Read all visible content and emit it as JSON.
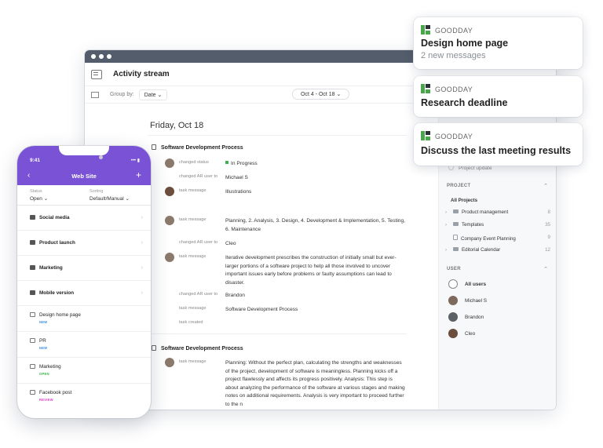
{
  "activity": {
    "window_title": "Activity stream",
    "group_by_label": "Group by:",
    "group_by_value": "Date",
    "date_range": "Oct 4 - Oct 18",
    "day_title": "Friday, Oct 18",
    "groups": [
      {
        "title": "Software Development Process",
        "entries": [
          {
            "label": "changed status",
            "value": "In Progress"
          },
          {
            "label": "changed AR user to",
            "value": "Michael S"
          },
          {
            "label": "task message",
            "value": "Illustrations"
          },
          {
            "label": "task message",
            "value": "Planning, 2. Analysis, 3. Design, 4. Development & Implementation, 5. Testing, 6. Maintenance"
          },
          {
            "label": "changed AR user to",
            "value": "Cleo"
          },
          {
            "label": "task message",
            "value": "Iterative development prescribes the construction of initially small but ever-larger portions of a software project to help all those involved to uncover important issues early before problems or faulty assumptions can lead to disaster."
          },
          {
            "label": "changed AR user to",
            "value": "Brandon"
          },
          {
            "label": "task message",
            "value": "Software Development Process"
          },
          {
            "label": "task created",
            "value": ""
          }
        ]
      },
      {
        "title": "Software Development Process",
        "entries": [
          {
            "label": "task message",
            "value": "Planning: Without the perfect plan, calculating the strengths and weaknesses of the project, development of software is meaningless. Planning kicks off a project flawlessly and affects its progress positively. Analysis: This step is about analyzing the performance of the software at various stages and making notes on additional requirements. Analysis is very important to proceed further to the n"
          }
        ]
      }
    ]
  },
  "right_pane": {
    "project_update": "Project update",
    "project_header": "PROJECT",
    "all_projects": "All Projects",
    "projects": [
      {
        "name": "Product management",
        "count": "8"
      },
      {
        "name": "Templates",
        "count": "35"
      },
      {
        "name": "Company Event Planning",
        "count": "9"
      },
      {
        "name": "Editorial Calendar",
        "count": "12"
      }
    ],
    "user_header": "USER",
    "users": [
      "All users",
      "Michael S",
      "Brandon",
      "Cleo"
    ]
  },
  "notifications": [
    {
      "brand": "GOODDAY",
      "title": "Design home page",
      "subtitle": "2 new messages"
    },
    {
      "brand": "GOODDAY",
      "title": "Research deadline"
    },
    {
      "brand": "GOODDAY",
      "title": "Discuss the last meeting results"
    }
  ],
  "phone": {
    "time": "9:41",
    "title": "Web Site",
    "status_caption": "Status",
    "status_value": "Open",
    "sorting_caption": "Sorting",
    "sorting_value": "Default/Manual",
    "folders": [
      "Social media",
      "Product launch",
      "Marketing",
      "Mobile version"
    ],
    "tasks": [
      {
        "name": "Design home page",
        "tag": "NEW",
        "tag_color": "#3d8fe0"
      },
      {
        "name": "PR",
        "tag": "NEW",
        "tag_color": "#3d8fe0"
      },
      {
        "name": "Marketing",
        "tag": "OPEN",
        "tag_color": "#3bb34a"
      },
      {
        "name": "Facebook post",
        "tag": "REVIEW",
        "tag_color": "#d63fc4"
      }
    ]
  },
  "colors": {
    "accent_purple": "#7a52d6",
    "goodday_green": "#49a64a",
    "titlebar": "#545d6c"
  }
}
